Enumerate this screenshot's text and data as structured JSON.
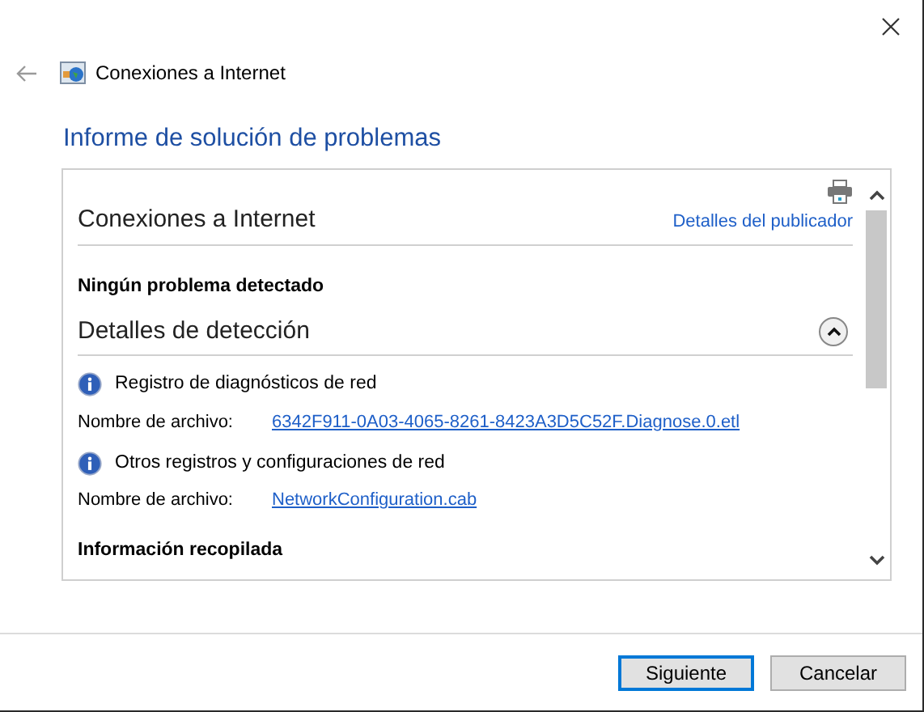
{
  "window": {
    "title": "Conexiones a Internet"
  },
  "heading": "Informe de solución de problemas",
  "report": {
    "title": "Conexiones a Internet",
    "publisher_link": "Detalles del publicador",
    "status": "Ningún problema detectado",
    "detection": {
      "title": "Detalles de detección",
      "expanded": true,
      "entries": [
        {
          "title": "Registro de diagnósticos de red",
          "label": "Nombre de archivo:",
          "file": "6342F911-0A03-4065-8261-8423A3D5C52F.Diagnose.0.etl"
        },
        {
          "title": "Otros registros y configuraciones de red",
          "label": "Nombre de archivo:",
          "file": "NetworkConfiguration.cab"
        }
      ]
    },
    "collected_title": "Información recopilada"
  },
  "buttons": [
    {
      "label": "Siguiente",
      "default": true
    },
    {
      "label": "Cancelar",
      "default": false
    }
  ]
}
